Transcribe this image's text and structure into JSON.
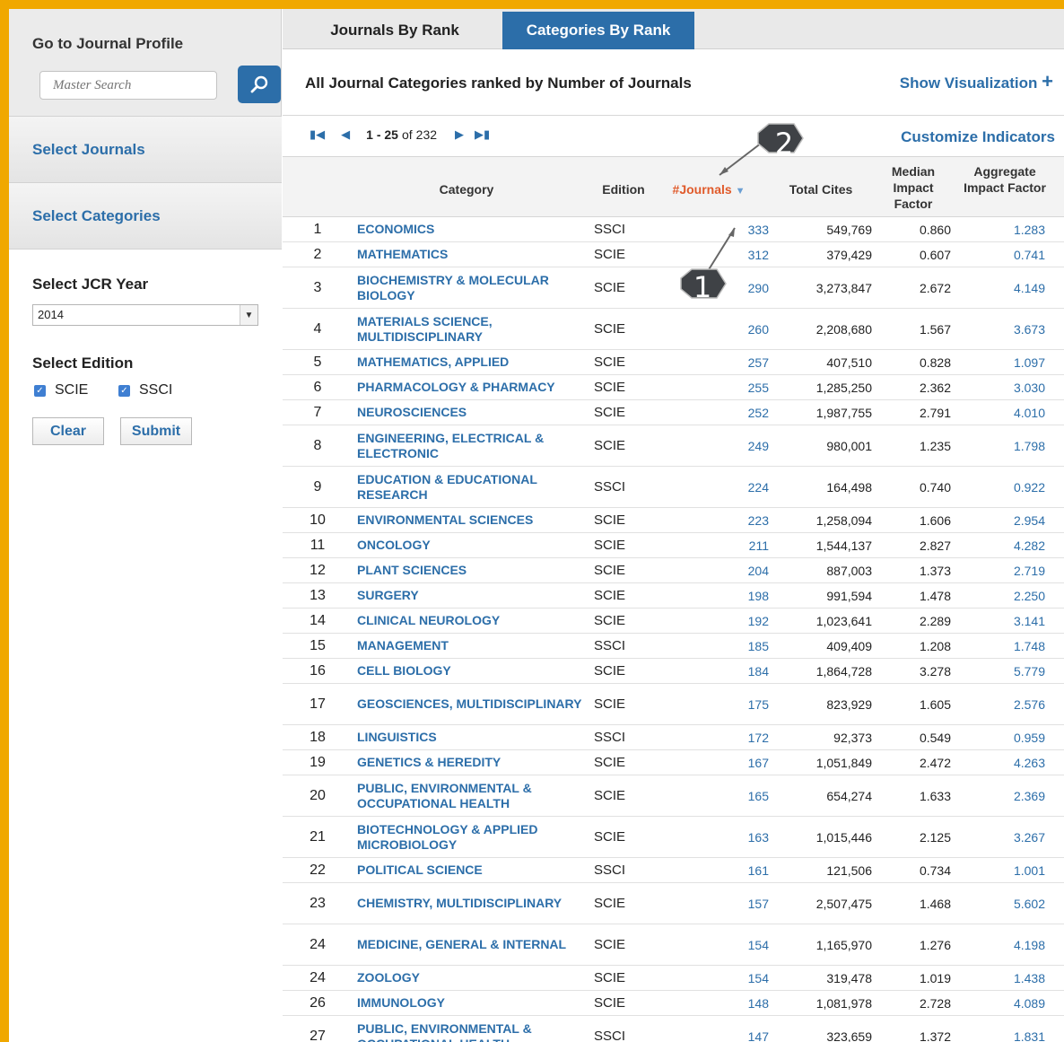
{
  "sidebar": {
    "profile_title": "Go to Journal Profile",
    "search_placeholder": "Master Search",
    "select_journals": "Select Journals",
    "select_categories": "Select Categories",
    "year_label": "Select JCR Year",
    "year_value": "2014",
    "edition_label": "Select Edition",
    "editions": [
      {
        "label": "SCIE",
        "checked": true
      },
      {
        "label": "SSCI",
        "checked": true
      }
    ],
    "clear_label": "Clear",
    "submit_label": "Submit"
  },
  "tabs": [
    {
      "label": "Journals By Rank",
      "active": false
    },
    {
      "label": "Categories By Rank",
      "active": true
    }
  ],
  "main": {
    "headline": "All Journal Categories ranked by Number of Journals",
    "show_visualization": "Show Visualization",
    "customize_indicators": "Customize Indicators",
    "pager": {
      "range": "1 - 25",
      "of_label": "of",
      "total": "232"
    }
  },
  "table": {
    "headers": {
      "category": "Category",
      "edition": "Edition",
      "journals": "#Journals",
      "total_cites": "Total Cites",
      "median_if": "Median Impact Factor",
      "aggregate_if": "Aggregate Impact Factor"
    },
    "rows": [
      {
        "rank": "1",
        "category": "ECONOMICS",
        "edition": "SSCI",
        "journals": "333",
        "total_cites": "549,769",
        "median_if": "0.860",
        "aggregate_if": "1.283"
      },
      {
        "rank": "2",
        "category": "MATHEMATICS",
        "edition": "SCIE",
        "journals": "312",
        "total_cites": "379,429",
        "median_if": "0.607",
        "aggregate_if": "0.741"
      },
      {
        "rank": "3",
        "category": "BIOCHEMISTRY & MOLECULAR BIOLOGY",
        "edition": "SCIE",
        "journals": "290",
        "total_cites": "3,273,847",
        "median_if": "2.672",
        "aggregate_if": "4.149"
      },
      {
        "rank": "4",
        "category": "MATERIALS SCIENCE, MULTIDISCIPLINARY",
        "edition": "SCIE",
        "journals": "260",
        "total_cites": "2,208,680",
        "median_if": "1.567",
        "aggregate_if": "3.673"
      },
      {
        "rank": "5",
        "category": "MATHEMATICS, APPLIED",
        "edition": "SCIE",
        "journals": "257",
        "total_cites": "407,510",
        "median_if": "0.828",
        "aggregate_if": "1.097"
      },
      {
        "rank": "6",
        "category": "PHARMACOLOGY & PHARMACY",
        "edition": "SCIE",
        "journals": "255",
        "total_cites": "1,285,250",
        "median_if": "2.362",
        "aggregate_if": "3.030"
      },
      {
        "rank": "7",
        "category": "NEUROSCIENCES",
        "edition": "SCIE",
        "journals": "252",
        "total_cites": "1,987,755",
        "median_if": "2.791",
        "aggregate_if": "4.010"
      },
      {
        "rank": "8",
        "category": "ENGINEERING, ELECTRICAL & ELECTRONIC",
        "edition": "SCIE",
        "journals": "249",
        "total_cites": "980,001",
        "median_if": "1.235",
        "aggregate_if": "1.798"
      },
      {
        "rank": "9",
        "category": "EDUCATION & EDUCATIONAL RESEARCH",
        "edition": "SSCI",
        "journals": "224",
        "total_cites": "164,498",
        "median_if": "0.740",
        "aggregate_if": "0.922"
      },
      {
        "rank": "10",
        "category": "ENVIRONMENTAL SCIENCES",
        "edition": "SCIE",
        "journals": "223",
        "total_cites": "1,258,094",
        "median_if": "1.606",
        "aggregate_if": "2.954"
      },
      {
        "rank": "11",
        "category": "ONCOLOGY",
        "edition": "SCIE",
        "journals": "211",
        "total_cites": "1,544,137",
        "median_if": "2.827",
        "aggregate_if": "4.282"
      },
      {
        "rank": "12",
        "category": "PLANT SCIENCES",
        "edition": "SCIE",
        "journals": "204",
        "total_cites": "887,003",
        "median_if": "1.373",
        "aggregate_if": "2.719"
      },
      {
        "rank": "13",
        "category": "SURGERY",
        "edition": "SCIE",
        "journals": "198",
        "total_cites": "991,594",
        "median_if": "1.478",
        "aggregate_if": "2.250"
      },
      {
        "rank": "14",
        "category": "CLINICAL NEUROLOGY",
        "edition": "SCIE",
        "journals": "192",
        "total_cites": "1,023,641",
        "median_if": "2.289",
        "aggregate_if": "3.141"
      },
      {
        "rank": "15",
        "category": "MANAGEMENT",
        "edition": "SSCI",
        "journals": "185",
        "total_cites": "409,409",
        "median_if": "1.208",
        "aggregate_if": "1.748"
      },
      {
        "rank": "16",
        "category": "CELL BIOLOGY",
        "edition": "SCIE",
        "journals": "184",
        "total_cites": "1,864,728",
        "median_if": "3.278",
        "aggregate_if": "5.779"
      },
      {
        "rank": "17",
        "category": "GEOSCIENCES, MULTIDISCIPLINARY",
        "edition": "SCIE",
        "journals": "175",
        "total_cites": "823,929",
        "median_if": "1.605",
        "aggregate_if": "2.576"
      },
      {
        "rank": "18",
        "category": "LINGUISTICS",
        "edition": "SSCI",
        "journals": "172",
        "total_cites": "92,373",
        "median_if": "0.549",
        "aggregate_if": "0.959"
      },
      {
        "rank": "19",
        "category": "GENETICS & HEREDITY",
        "edition": "SCIE",
        "journals": "167",
        "total_cites": "1,051,849",
        "median_if": "2.472",
        "aggregate_if": "4.263"
      },
      {
        "rank": "20",
        "category": "PUBLIC, ENVIRONMENTAL & OCCUPATIONAL HEALTH",
        "edition": "SCIE",
        "journals": "165",
        "total_cites": "654,274",
        "median_if": "1.633",
        "aggregate_if": "2.369"
      },
      {
        "rank": "21",
        "category": "BIOTECHNOLOGY & APPLIED MICROBIOLOGY",
        "edition": "SCIE",
        "journals": "163",
        "total_cites": "1,015,446",
        "median_if": "2.125",
        "aggregate_if": "3.267"
      },
      {
        "rank": "22",
        "category": "POLITICAL SCIENCE",
        "edition": "SSCI",
        "journals": "161",
        "total_cites": "121,506",
        "median_if": "0.734",
        "aggregate_if": "1.001"
      },
      {
        "rank": "23",
        "category": "CHEMISTRY, MULTIDISCIPLINARY",
        "edition": "SCIE",
        "journals": "157",
        "total_cites": "2,507,475",
        "median_if": "1.468",
        "aggregate_if": "5.602"
      },
      {
        "rank": "24",
        "category": "MEDICINE, GENERAL & INTERNAL",
        "edition": "SCIE",
        "journals": "154",
        "total_cites": "1,165,970",
        "median_if": "1.276",
        "aggregate_if": "4.198"
      },
      {
        "rank": "24",
        "category": "ZOOLOGY",
        "edition": "SCIE",
        "journals": "154",
        "total_cites": "319,478",
        "median_if": "1.019",
        "aggregate_if": "1.438"
      },
      {
        "rank": "26",
        "category": "IMMUNOLOGY",
        "edition": "SCIE",
        "journals": "148",
        "total_cites": "1,081,978",
        "median_if": "2.728",
        "aggregate_if": "4.089"
      },
      {
        "rank": "27",
        "category": "PUBLIC, ENVIRONMENTAL & OCCUPATIONAL HEALTH",
        "edition": "SSCI",
        "journals": "147",
        "total_cites": "323,659",
        "median_if": "1.372",
        "aggregate_if": "1.831"
      }
    ]
  },
  "callouts": [
    {
      "label": "1"
    },
    {
      "label": "2"
    }
  ],
  "colors": {
    "accent": "#2c6ea9",
    "sorted_header": "#e05a2a",
    "frame": "#f0a800",
    "callout_fill": "#3f4246"
  }
}
